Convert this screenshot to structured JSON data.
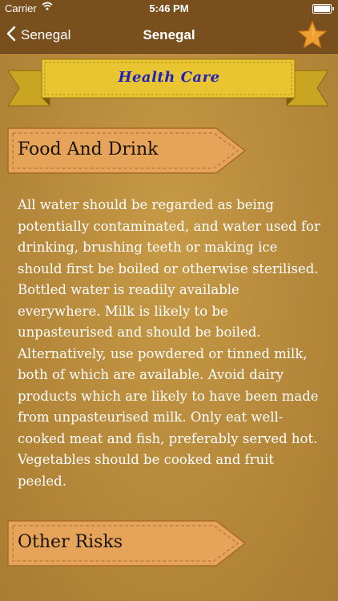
{
  "status_bar": {
    "carrier": "Carrier",
    "time": "5:46 PM"
  },
  "nav": {
    "back_label": "Senegal",
    "title": "Senegal"
  },
  "header_ribbon": {
    "label": "Health Care"
  },
  "sections": [
    {
      "title": "Food And Drink",
      "body": "All water should be regarded as being potentially contaminated, and water used for drinking, brushing teeth or making ice should first be boiled or otherwise sterilised. Bottled water is readily available everywhere. Milk is likely to be unpasteurised and should be boiled. Alternatively, use powdered or tinned milk, both of which are available. Avoid dairy products which are likely to have been made from unpasteurised milk. Only eat well-cooked meat and fish, preferably served hot. Vegetables should be cooked and fruit peeled."
    },
    {
      "title": "Other Risks"
    }
  ],
  "colors": {
    "bar": "#7a4f1e",
    "background": "#b98b3a",
    "ribbon": "#e8c531",
    "banner": "#e6a35a",
    "star": "#f0a030"
  },
  "icons": {
    "back": "chevron-left-icon",
    "favorite": "star-icon",
    "wifi": "wifi-icon",
    "battery": "battery-icon"
  }
}
